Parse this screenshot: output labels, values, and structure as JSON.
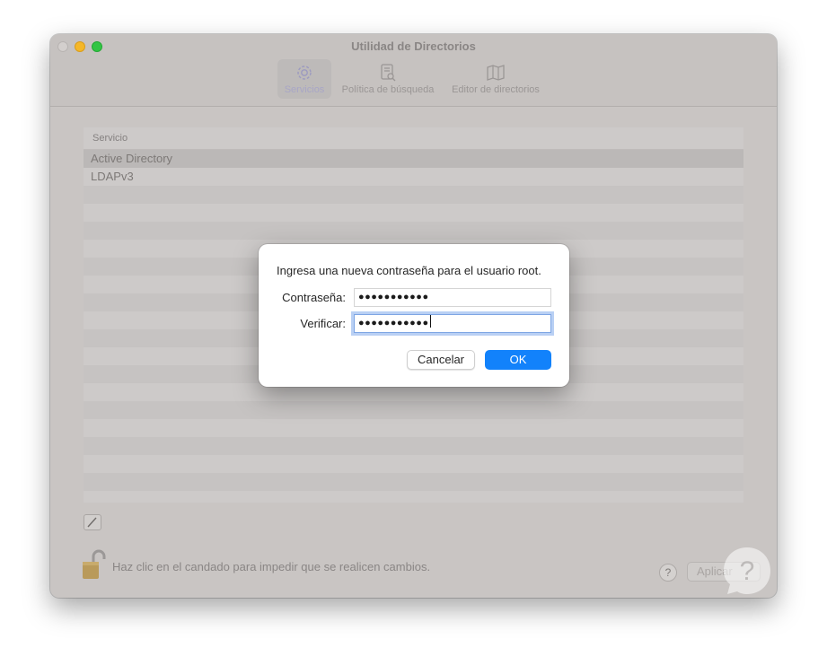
{
  "window": {
    "title": "Utilidad de Directorios"
  },
  "toolbar": {
    "items": [
      {
        "label": "Servicios",
        "icon": "gear-icon",
        "active": true
      },
      {
        "label": "Política de búsqueda",
        "icon": "search-policy-icon",
        "active": false
      },
      {
        "label": "Editor de directorios",
        "icon": "map-icon",
        "active": false
      }
    ]
  },
  "services_table": {
    "column_header": "Servicio",
    "rows": [
      "Active Directory",
      "LDAPv3"
    ],
    "selected_row": "Active Directory"
  },
  "footer": {
    "lock_message": "Haz clic en el candado para impedir que se realicen cambios.",
    "help_label": "?",
    "apply_label": "Aplicar"
  },
  "dialog": {
    "message": "Ingresa una nueva contraseña para el usuario root.",
    "password_label": "Contraseña:",
    "password_value": "●●●●●●●●●●●",
    "verify_label": "Verificar:",
    "verify_value": "●●●●●●●●●●●",
    "cancel_label": "Cancelar",
    "ok_label": "OK"
  },
  "colors": {
    "accent": "#1282fb",
    "window_bg": "#c9c5c3"
  }
}
